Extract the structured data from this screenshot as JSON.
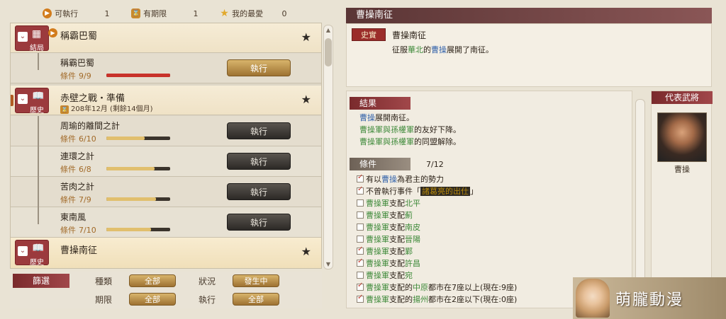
{
  "counters": [
    {
      "label": "可執行",
      "value": "1",
      "icon": "play-icon"
    },
    {
      "label": "有期限",
      "value": "1",
      "icon": "hourglass-icon"
    },
    {
      "label": "我的最愛",
      "value": "0",
      "icon": "star-icon"
    }
  ],
  "list": {
    "groups": [
      {
        "badge_text": "結局",
        "title": "稱霸巴蜀",
        "subs": [
          {
            "title": "稱霸巴蜀",
            "cond_label": "條件",
            "cond_value": "9/9",
            "progress": 1.0,
            "exec": "執行"
          }
        ]
      },
      {
        "badge_text": "歷史",
        "title": "赤壁之戰・準備",
        "new_tag": "新",
        "date": "208年12月 (剩餘14個月)",
        "subs": [
          {
            "title": "周瑜的離間之計",
            "cond_label": "條件",
            "cond_value": "6/10",
            "progress": 0.6,
            "exec": "執行"
          },
          {
            "title": "連環之計",
            "cond_label": "條件",
            "cond_value": "6/8",
            "progress": 0.75,
            "exec": "執行"
          },
          {
            "title": "苦肉之計",
            "cond_label": "條件",
            "cond_value": "7/9",
            "progress": 0.78,
            "exec": "執行"
          },
          {
            "title": "東南風",
            "cond_label": "條件",
            "cond_value": "7/10",
            "progress": 0.7,
            "exec": "執行"
          }
        ]
      },
      {
        "badge_text": "歷史",
        "title": "曹操南征"
      }
    ]
  },
  "filter": {
    "title": "篩選",
    "type_label": "種類",
    "type_value": "全部",
    "status_label": "狀況",
    "status_value": "發生中",
    "period_label": "期限",
    "period_value": "全部",
    "exec_label": "執行",
    "exec_value": "全部"
  },
  "detail": {
    "header": "曹操南征",
    "tag": "史實",
    "title": "曹操南征",
    "desc_parts": [
      "征服",
      "華北",
      "的",
      "曹操",
      "展開了南征。"
    ],
    "result_heading": "結果",
    "results": [
      [
        "曹操",
        "展開南征。"
      ],
      [
        "曹操軍與孫權軍",
        "的友好下降。"
      ],
      [
        "曹操軍與孫權軍",
        "的同盟解除。"
      ]
    ],
    "cond_heading": "條件",
    "cond_count": "7/12",
    "conditions": [
      {
        "checked": true,
        "parts": [
          "有以",
          "曹操",
          "為君主的勢力"
        ]
      },
      {
        "checked": true,
        "parts": [
          "不曾執行事件「",
          "諸葛亮的出仕",
          "」"
        ]
      },
      {
        "checked": false,
        "parts": [
          "曹操軍",
          "支配",
          "北平"
        ]
      },
      {
        "checked": false,
        "parts": [
          "曹操軍",
          "支配",
          "薊"
        ]
      },
      {
        "checked": false,
        "parts": [
          "曹操軍",
          "支配",
          "南皮"
        ]
      },
      {
        "checked": false,
        "parts": [
          "曹操軍",
          "支配",
          "晉陽"
        ]
      },
      {
        "checked": true,
        "parts": [
          "曹操軍",
          "支配",
          "鄴"
        ]
      },
      {
        "checked": true,
        "parts": [
          "曹操軍",
          "支配",
          "許昌"
        ]
      },
      {
        "checked": false,
        "parts": [
          "曹操軍",
          "支配",
          "宛"
        ]
      },
      {
        "checked": true,
        "parts": [
          "曹操軍",
          "支配的",
          "中原",
          "都市在7座以上(現在:9座)"
        ]
      },
      {
        "checked": true,
        "parts": [
          "曹操軍",
          "支配的",
          "揚州",
          "都市在2座以下(現在:0座)"
        ]
      }
    ]
  },
  "general": {
    "heading": "代表武將",
    "name": "曹操"
  },
  "watermark": "萌朧動漫",
  "colors": {
    "accent_red": "#9b3a3d",
    "gold": "#d8b46b",
    "blue_text": "#2e5fa8",
    "green_text": "#3f8a3a"
  }
}
